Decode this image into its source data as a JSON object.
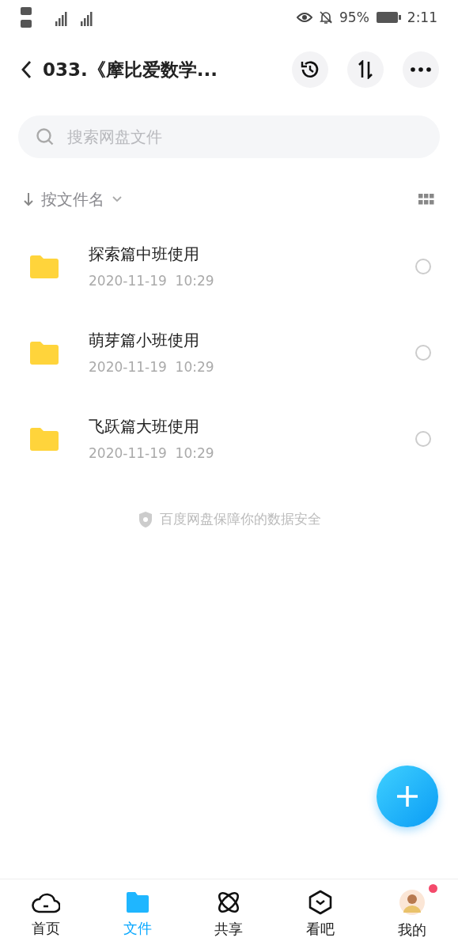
{
  "status_bar": {
    "battery": "95%",
    "time": "2:11"
  },
  "header": {
    "title": "033.《摩比爱数学..."
  },
  "search": {
    "placeholder": "搜索网盘文件"
  },
  "sort": {
    "label": "按文件名"
  },
  "files": [
    {
      "name": "探索篇中班使用",
      "date": "2020-11-19  10:29",
      "selected": false
    },
    {
      "name": "萌芽篇小班使用",
      "date": "2020-11-19  10:29",
      "selected": false
    },
    {
      "name": "飞跃篇大班使用",
      "date": "2020-11-19  10:29",
      "selected": false
    }
  ],
  "notice": "百度网盘保障你的数据安全",
  "tabs": [
    {
      "kind": "home",
      "label": "首页",
      "selected": false
    },
    {
      "kind": "files",
      "label": "文件",
      "selected": true
    },
    {
      "kind": "share",
      "label": "共享",
      "selected": false
    },
    {
      "kind": "watch",
      "label": "看吧",
      "selected": false
    },
    {
      "kind": "me",
      "label": "我的",
      "selected": false,
      "badge": true
    }
  ]
}
